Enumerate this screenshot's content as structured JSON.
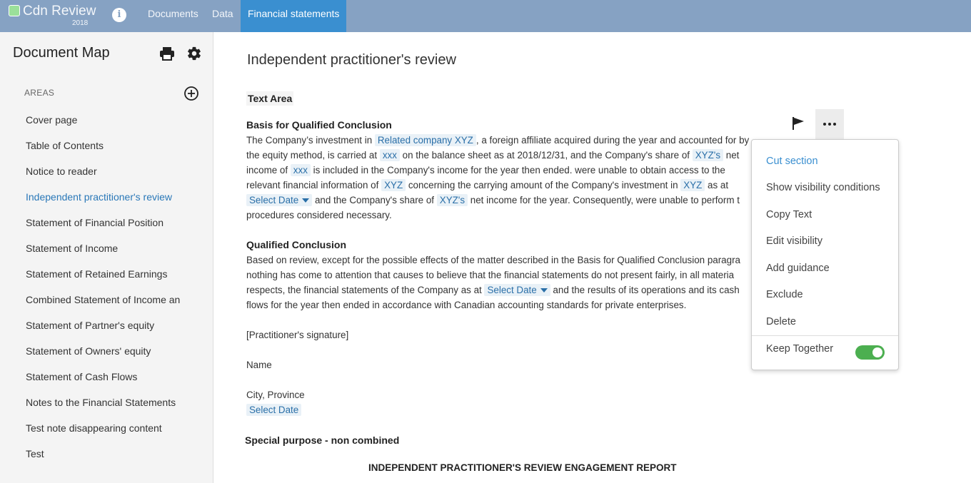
{
  "app": {
    "name": "Cdn Review",
    "year": "2018"
  },
  "nav": {
    "tabs": [
      "Documents",
      "Data",
      "Financial statements"
    ],
    "active_index": 2
  },
  "sidebar": {
    "title": "Document Map",
    "areas_label": "AREAS",
    "items": [
      "Cover page",
      "Table of Contents",
      "Notice to reader",
      "Independent practitioner's review",
      "Statement of Financial Position",
      "Statement of Income",
      "Statement of Retained Earnings",
      "Combined Statement of Income an",
      "Statement of Partner's equity",
      "Statement of Owners' equity",
      "Statement of Cash Flows",
      "Notes to the Financial Statements",
      "Test note disappearing content",
      "Test"
    ],
    "active_item": "Independent practitioner's review"
  },
  "main": {
    "title": "Independent practitioner's review",
    "text_area_label": "Text Area",
    "basis": {
      "heading": "Basis for Qualified Conclusion",
      "l1a": "The Company’s investment in",
      "f1": "Related company XYZ",
      "l1b": ", a foreign affiliate acquired during the year and accounted for by",
      "l2a": "the equity method, is carried at",
      "f2": "xxx",
      "l2b": " on the balance sheet as at 2018/12/31, and the Company's share of",
      "f3": "XYZ's",
      "l2c": " net",
      "l3a": "income of",
      "f4": "xxx",
      "l3b": " is included in the Company's income for the year then ended. were unable to obtain access to the",
      "l4a": "relevant financial information of",
      "f5": "XYZ",
      "l4b": " concerning the carrying amount of the Company's investment in",
      "f6": "XYZ",
      "l4c": " as at",
      "f7": "Select Date",
      "l5a": " and the Company's share of",
      "f8": "XYZ's",
      "l5b": " net income for the year. Consequently, were unable to perform t",
      "l6": "procedures considered necessary."
    },
    "qualified": {
      "heading": "Qualified Conclusion",
      "l1": "Based on review, except for the possible effects of the matter described in the Basis for Qualified Conclusion paragra",
      "l2": "nothing has come to attention that causes to believe that the financial statements do not present fairly, in all materia",
      "l3a": "respects, the financial statements of the Company as at",
      "f1": "Select Date",
      "l3b": " and the results of its operations and its cash",
      "l4": "flows for the year then ended in accordance with Canadian accounting standards for private enterprises."
    },
    "signature": "[Practitioner's signature]",
    "name": "Name",
    "city": "City, Province",
    "select_date": "Select Date",
    "special_purpose": "Special purpose - non combined",
    "report_heading": "INDEPENDENT PRACTITIONER'S REVIEW ENGAGEMENT REPORT"
  },
  "menu": {
    "items": [
      "Cut section",
      "Show visibility conditions",
      "Copy Text",
      "Edit visibility",
      "Add guidance",
      "Exclude",
      "Delete"
    ],
    "toggle_label": "Keep Together",
    "toggle_on": true
  },
  "colors": {
    "topbar": "#86a2c3",
    "active_tab": "#3a8fd0",
    "accent": "#2a78b8",
    "toggle": "#4caf50"
  }
}
